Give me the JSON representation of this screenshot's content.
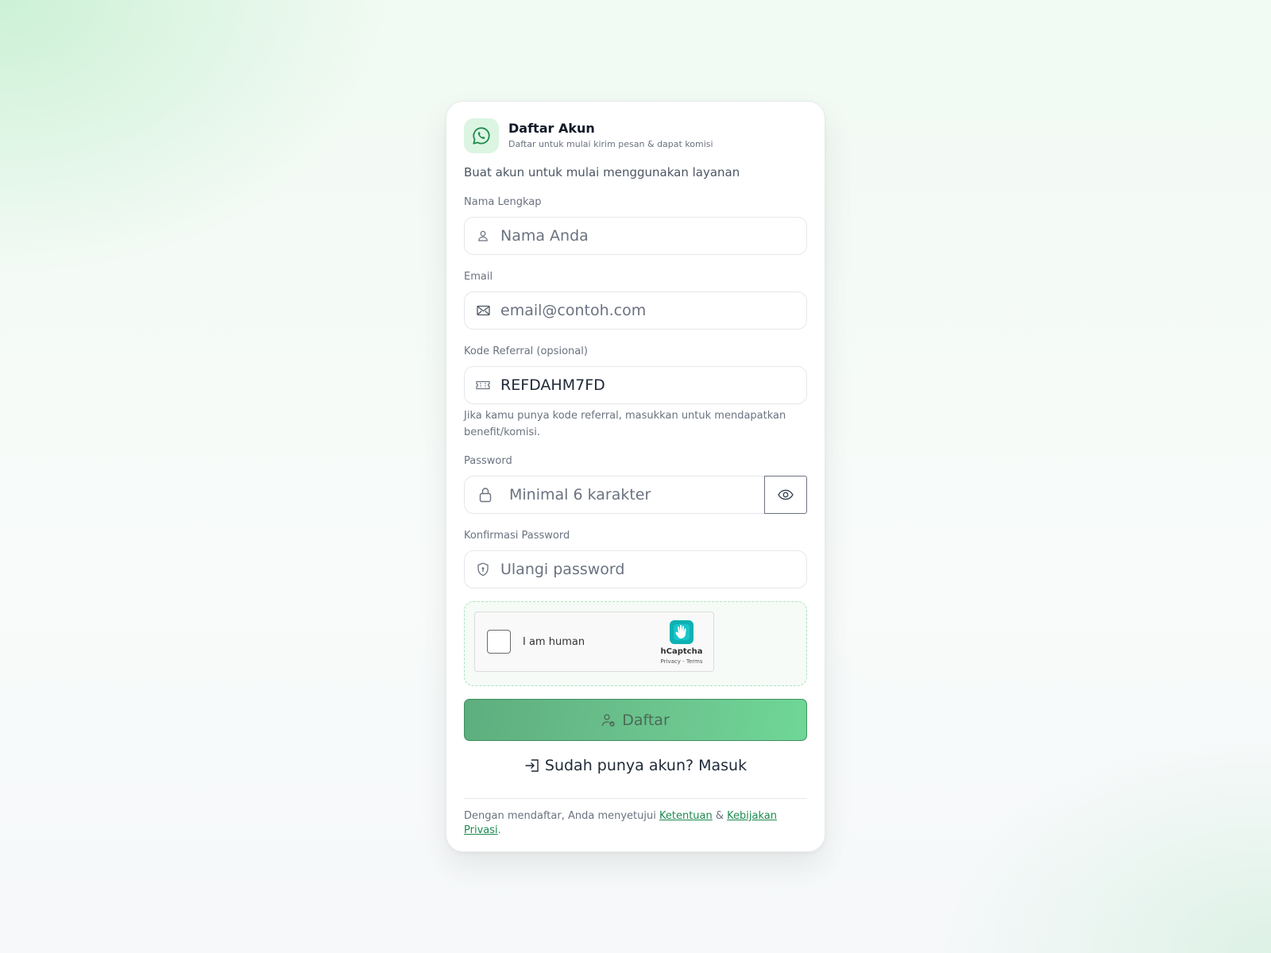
{
  "colors": {
    "accent": "#25a05c",
    "card_bg": "#ffffff",
    "button_gradient_start": "#5eae7e",
    "button_gradient_end": "#6fd797",
    "link": "#1c8a4f"
  },
  "header": {
    "logo_icon": "whatsapp-icon",
    "title": "Daftar Akun",
    "subtitle": "Daftar untuk mulai kirim pesan & dapat komisi"
  },
  "intro": "Buat akun untuk mulai menggunakan layanan",
  "fields": {
    "name": {
      "label": "Nama Lengkap",
      "placeholder": "Nama Anda",
      "value": "",
      "icon": "user-icon"
    },
    "email": {
      "label": "Email",
      "placeholder": "email@contoh.com",
      "value": "",
      "icon": "mail-icon"
    },
    "referral": {
      "label": "Kode Referral (opsional)",
      "value": "REFDAHM7FD",
      "icon": "ticket-icon",
      "hint": "Jika kamu punya kode referral, masukkan untuk mendapatkan benefit/komisi."
    },
    "password": {
      "label": "Password",
      "placeholder": "Minimal 6 karakter",
      "value": "",
      "icon": "lock-icon",
      "toggle_icon": "eye-icon"
    },
    "confirm": {
      "label": "Konfirmasi Password",
      "placeholder": "Ulangi password",
      "value": "",
      "icon": "shield-icon"
    }
  },
  "captcha": {
    "text": "I am human",
    "brand": "hCaptcha",
    "links": "Privacy - Terms"
  },
  "submit": {
    "label": "Daftar",
    "icon": "user-check-icon"
  },
  "login_link": {
    "label": "Sudah punya akun? Masuk",
    "icon": "login-icon"
  },
  "terms": {
    "prefix": "Dengan mendaftar, Anda menyetujui ",
    "link1": "Ketentuan",
    "joiner": " & ",
    "link2": "Kebijakan Privasi",
    "suffix": "."
  }
}
